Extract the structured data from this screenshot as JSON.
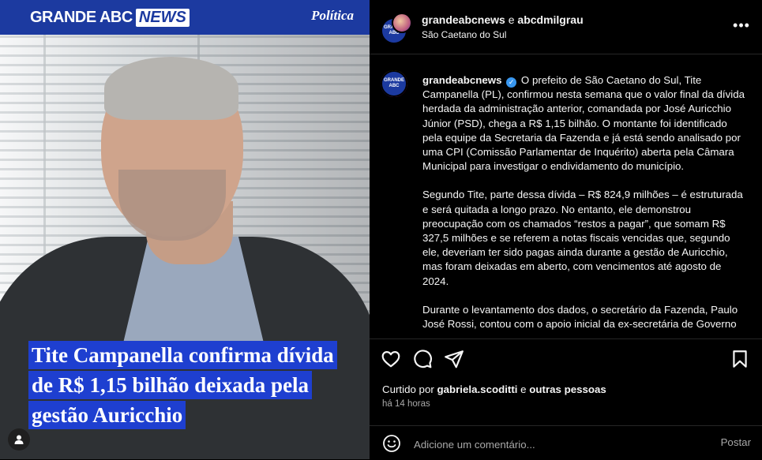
{
  "media": {
    "logo_text": "GRANDE ABC",
    "logo_badge": "NEWS",
    "section": "Política",
    "headline_lines": [
      "Tite Campanella confirma dívida",
      "de R$ 1,15 bilhão deixada pela",
      "gestão Auricchio"
    ]
  },
  "header": {
    "author": "grandeabcnews",
    "conjunction": "e",
    "coauthor": "abcdmilgrau",
    "location": "São Caetano do Sul",
    "more_icon": "more-horizontal-icon"
  },
  "caption": {
    "username": "grandeabcnews",
    "paragraphs": [
      "O prefeito de São Caetano do Sul, Tite Campanella (PL), confirmou nesta semana que o valor final da dívida herdada da administração anterior, comandada por José Auricchio Júnior (PSD), chega a R$ 1,15 bilhão. O montante foi identificado pela equipe da Secretaria da Fazenda e já está sendo analisado por uma CPI (Comissão Parlamentar de Inquérito) aberta pela Câmara Municipal para investigar o endividamento do município.",
      "Segundo Tite, parte dessa dívida – R$ 824,9 milhões – é estruturada e será quitada a longo prazo. No entanto, ele demonstrou preocupação com os chamados “restos a pagar”, que somam R$ 327,5 milhões e se referem a notas fiscais vencidas que, segundo ele, deveriam ter sido pagas ainda durante a gestão de Auricchio, mas foram deixadas em aberto, com vencimentos até agosto de 2024.",
      "Durante o levantamento dos dados, o secretário da Fazenda, Paulo José Rossi, contou com o apoio inicial da ex-secretária de Governo"
    ]
  },
  "actions": {
    "liked_prefix": "Curtido por",
    "liked_user": "gabriela.scoditti",
    "liked_conj": "e",
    "liked_others": "outras pessoas",
    "time": "há 14 horas"
  },
  "comment": {
    "placeholder": "Adicione um comentário...",
    "post_label": "Postar"
  },
  "colors": {
    "brand_blue": "#1c3aa0",
    "headline_blue": "#1e3fd0",
    "verified": "#3897f0"
  }
}
